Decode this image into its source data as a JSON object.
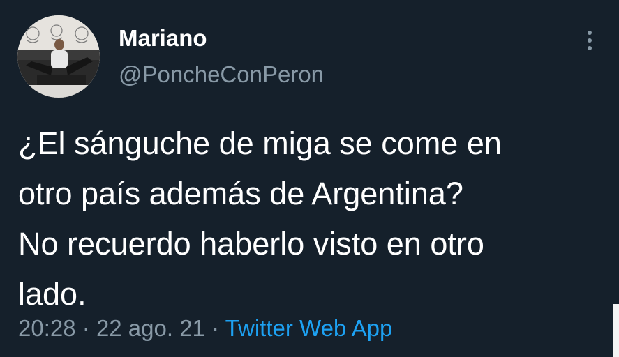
{
  "user": {
    "display_name": "Mariano",
    "handle": "@PoncheConPeron"
  },
  "tweet": {
    "text": "¿El sánguche de miga se come en\notro país además de Argentina?\nNo recuerdo haberlo visto en otro\nlado.",
    "time": "20:28",
    "separator": "·",
    "date": "22 ago. 21",
    "source": "Twitter Web App"
  },
  "icons": {
    "more": "more-vertical-icon"
  },
  "colors": {
    "background": "#15202b",
    "text_primary": "#ffffff",
    "text_secondary": "#8899a6",
    "link": "#1da1f2"
  }
}
